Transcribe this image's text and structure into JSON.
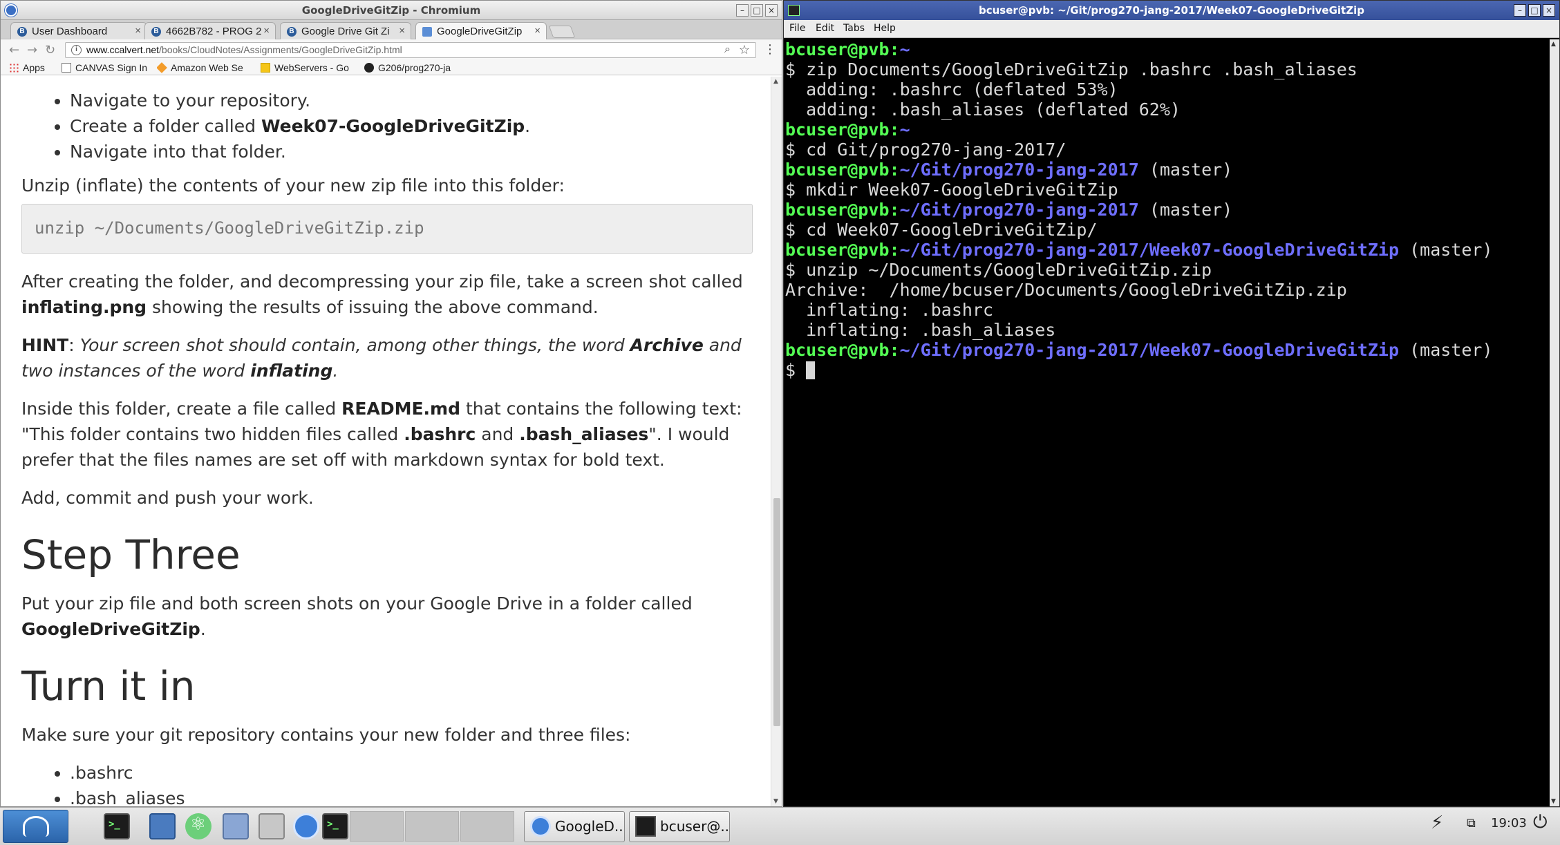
{
  "browser": {
    "window_title": "GoogleDriveGitZip - Chromium",
    "tabs": [
      {
        "label": "User Dashboard",
        "favicon": "b-icon"
      },
      {
        "label": "4662B782 - PROG 2",
        "favicon": "b-icon"
      },
      {
        "label": "Google Drive Git Zi",
        "favicon": "b-icon"
      },
      {
        "label": "GoogleDriveGitZip",
        "favicon": "doc-icon",
        "active": true
      }
    ],
    "url_host": "www.ccalvert.net",
    "url_path": "/books/CloudNotes/Assignments/GoogleDriveGitZip.html",
    "bookmarks": [
      {
        "label": "Apps"
      },
      {
        "label": "CANVAS Sign In"
      },
      {
        "label": "Amazon Web Se"
      },
      {
        "label": "WebServers - Go"
      },
      {
        "label": "G206/prog270-ja"
      }
    ]
  },
  "page": {
    "list1": [
      "Navigate to your repository.",
      "Create a folder called ",
      "Week07-GoogleDriveGitZip",
      ".",
      "Navigate into that folder."
    ],
    "p_unzip": "Unzip (inflate) the contents of your new zip file into this folder:",
    "code": "unzip ~/Documents/GoogleDriveGitZip.zip",
    "p_after_1": "After creating the folder, and decompressing your zip file, take a screen shot called",
    "p_after_file": "inflating.png",
    "p_after_2": " showing the results of issuing the above command.",
    "hint_label": "HINT",
    "hint_1": "Your screen shot should contain, among other things, the word ",
    "hint_archive": "Archive",
    "hint_2": " and two instances of the word ",
    "hint_inflating": "inflating",
    "hint_3": ".",
    "readme_1": "Inside this folder, create a file called ",
    "readme_file": "README.md",
    "readme_2": " that contains the following text: \"This folder contains two hidden files called ",
    "readme_bashrc": ".bashrc",
    "readme_and": " and ",
    "readme_aliases": ".bash_aliases",
    "readme_3": "\". I would prefer that the files names are set off with markdown syntax for bold text.",
    "p_commit": "Add, commit and push your work.",
    "h_step3": "Step Three",
    "step3_1": "Put your zip file and both screen shots on your Google Drive in a folder called ",
    "step3_folder": "GoogleDriveGitZip",
    "step3_2": ".",
    "h_turn": "Turn it in",
    "turn_p": "Make sure your git repository contains your new folder and three files:",
    "turn_list": [
      ".bashrc",
      ".bash_aliases"
    ]
  },
  "terminal": {
    "window_title": "bcuser@pvb: ~/Git/prog270-jang-2017/Week07-GoogleDriveGitZip",
    "menu": [
      "File",
      "Edit",
      "Tabs",
      "Help"
    ],
    "user_host": "bcuser@pvb",
    "lines": [
      {
        "type": "prompt",
        "path": "~",
        "branch": ""
      },
      {
        "type": "out",
        "text": "$ zip Documents/GoogleDriveGitZip .bashrc .bash_aliases"
      },
      {
        "type": "out",
        "text": "  adding: .bashrc (deflated 53%)"
      },
      {
        "type": "out",
        "text": "  adding: .bash_aliases (deflated 62%)"
      },
      {
        "type": "prompt",
        "path": "~",
        "branch": ""
      },
      {
        "type": "out",
        "text": "$ cd Git/prog270-jang-2017/"
      },
      {
        "type": "prompt",
        "path": "~/Git/prog270-jang-2017",
        "branch": " (master)"
      },
      {
        "type": "out",
        "text": "$ mkdir Week07-GoogleDriveGitZip"
      },
      {
        "type": "prompt",
        "path": "~/Git/prog270-jang-2017",
        "branch": " (master)"
      },
      {
        "type": "out",
        "text": "$ cd Week07-GoogleDriveGitZip/"
      },
      {
        "type": "prompt",
        "path": "~/Git/prog270-jang-2017/Week07-GoogleDriveGitZip",
        "branch": " (master)"
      },
      {
        "type": "out",
        "text": "$ unzip ~/Documents/GoogleDriveGitZip.zip"
      },
      {
        "type": "out",
        "text": "Archive:  /home/bcuser/Documents/GoogleDriveGitZip.zip"
      },
      {
        "type": "out",
        "text": "  inflating: .bashrc"
      },
      {
        "type": "out",
        "text": "  inflating: .bash_aliases"
      },
      {
        "type": "prompt",
        "path": "~/Git/prog270-jang-2017/Week07-GoogleDriveGitZip",
        "branch": " (master)"
      },
      {
        "type": "cursor",
        "text": "$ "
      }
    ]
  },
  "taskbar": {
    "tasks": [
      "GoogleD...",
      "bcuser@..."
    ],
    "clock": "19:03"
  }
}
